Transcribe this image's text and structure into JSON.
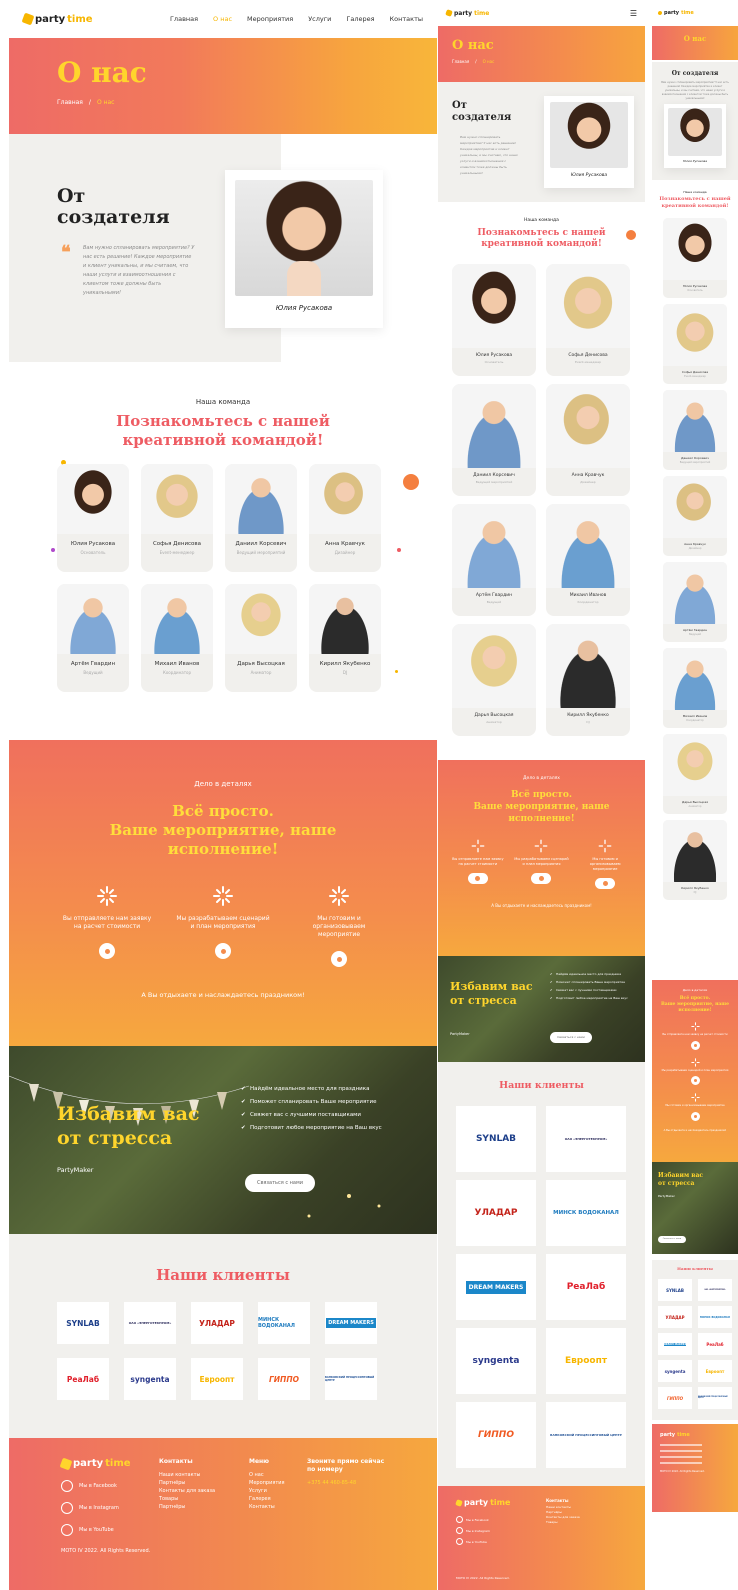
{
  "site": {
    "logo_part1": "party",
    "logo_part2": "time"
  },
  "nav": {
    "items": [
      "Главная",
      "О нас",
      "Мероприятия",
      "Услуги",
      "Галерея",
      "Контакты"
    ],
    "active_index": 1
  },
  "hero": {
    "title": "О нас",
    "crumb_home": "Главная",
    "crumb_sep": "/",
    "crumb_current": "О нас"
  },
  "founder": {
    "title_line1": "От",
    "title_line2": "создателя",
    "quote": "Вам нужно спланировать мероприятие? У нас есть решение! Каждое мероприятие и клиент уникальны, и мы считаем, что наши услуги и взаимоотношения с клиентом тоже должны быть уникальными!",
    "name": "Юлия Русакова"
  },
  "team": {
    "overline": "Наша команда",
    "title_line1": "Познакомьтесь с нашей",
    "title_line2": "креативной командой!",
    "members": [
      {
        "name": "Юлия Русакова",
        "role": "Основатель"
      },
      {
        "name": "Софья Денисова",
        "role": "Event-менеджер"
      },
      {
        "name": "Даниил Корсевич",
        "role": "Ведущий мероприятий"
      },
      {
        "name": "Анна Кравчук",
        "role": "Дизайнер"
      },
      {
        "name": "Артём Гвардин",
        "role": "Ведущий"
      },
      {
        "name": "Михаил Иванов",
        "role": "Координатор"
      },
      {
        "name": "Дарья Высоцкая",
        "role": "Аниматор"
      },
      {
        "name": "Кирилл Якубенко",
        "role": "DJ"
      }
    ]
  },
  "steps": {
    "overline": "Дело в деталях",
    "title_line1": "Всё просто.",
    "title_line2": "Ваше мероприятие, наше",
    "title_line3": "исполнение!",
    "items": [
      "Вы отправляете нам заявку на расчет стоимости",
      "Мы разрабатываем сценарий и план мероприятия",
      "Мы готовим и организовываем мероприятие"
    ],
    "footer": "А Вы отдыхаете и наслаждаетесь праздником!"
  },
  "stress": {
    "title_line1": "Избавим вас",
    "title_line2": "от стресса",
    "brand": "PartyMaker",
    "checks": [
      "Найдём идеальное место для праздника",
      "Поможет спланировать Ваше мероприятие",
      "Свяжет вас с лучшими поставщиками",
      "Подготовит любое мероприятие на Ваш вкус"
    ],
    "button": "Связаться с нами"
  },
  "clients": {
    "title": "Наши клиенты",
    "logos": [
      "SYNLAB",
      "ОАО «ЭНЕРГОТЕКПРОМ»",
      "УЛАДАР",
      "МИНСК ВОДОКАНАЛ",
      "DREAM MAKERS",
      "РеаЛаб",
      "syngenta",
      "Евроопт",
      "ГИППО",
      "БАНКОВСКИЙ ПРОЦЕССИНГОВЫЙ ЦЕНТР"
    ]
  },
  "footer": {
    "contacts": [
      "Мы в Facebook",
      "Мы в Instagram",
      "Мы в YouTube"
    ],
    "col1_title": "Контакты",
    "col1_items": [
      "Наши контакты",
      "Партнёры",
      "Контакты для заказа",
      "Товары",
      "Партнёры"
    ],
    "col2_title": "Меню",
    "col2_items": [
      "О нас",
      "Мероприятия",
      "Услуги",
      "Галерея",
      "Контакты"
    ],
    "col3_title": "Звоните прямо сейчас по номеру",
    "phone": "+375 44 460-85-48",
    "copyright": "MOTO IV 2022. All Rights Reserved."
  },
  "colors": {
    "accent_yellow": "#ffd52c",
    "accent_pink": "#ee5c63",
    "accent_orange": "#f48c4d"
  }
}
